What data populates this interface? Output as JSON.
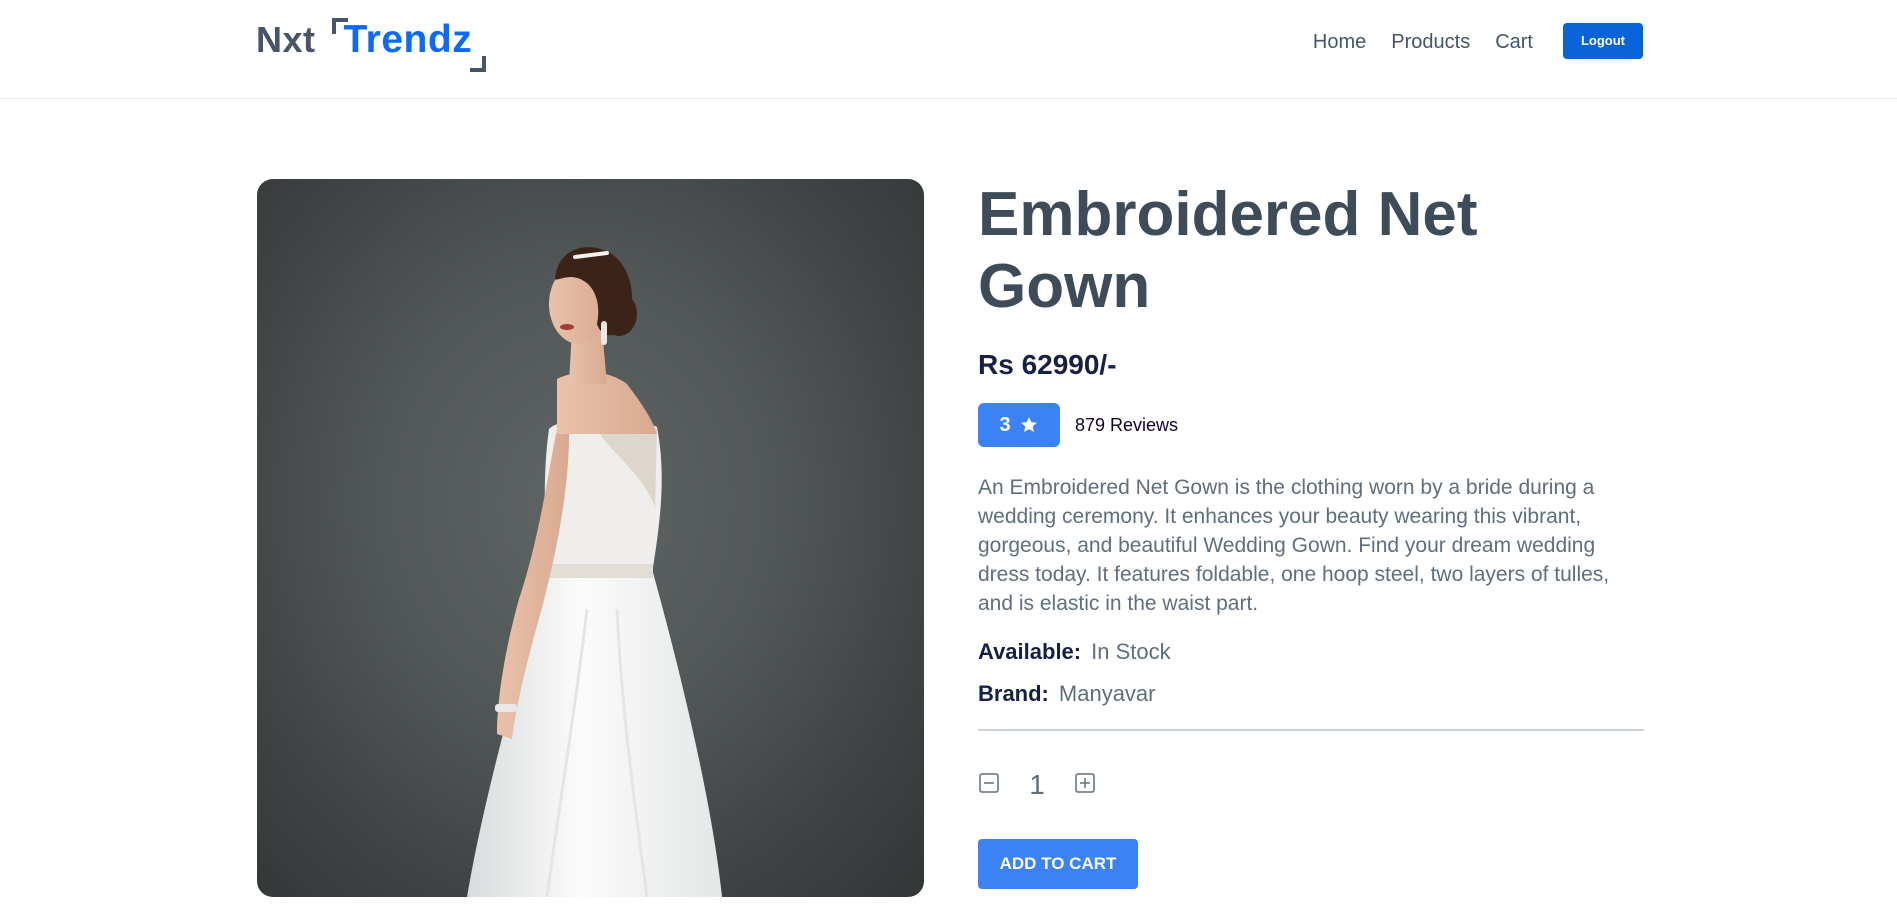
{
  "header": {
    "logo_part1": "Nxt",
    "logo_part2": "Trendz",
    "nav": [
      {
        "label": "Home"
      },
      {
        "label": "Products"
      },
      {
        "label": "Cart"
      }
    ],
    "logout_label": "Logout"
  },
  "product": {
    "image_alt": "bride in white embroidered net gown",
    "title": "Embroidered Net Gown",
    "price": "Rs 62990/-",
    "rating": "3",
    "rating_icon": "star-icon",
    "reviews": "879 Reviews",
    "description": "An Embroidered Net Gown is the clothing worn by a bride during a wedding ceremony. It enhances your beauty wearing this vibrant, gorgeous, and beautiful Wedding Gown. Find your dream wedding dress today. It features foldable, one hoop steel, two layers of tulles, and is elastic in the waist part.",
    "available_label": "Available:",
    "available_value": "In Stock",
    "brand_label": "Brand:",
    "brand_value": "Manyavar",
    "quantity": "1",
    "decrement_icon": "minus-square-icon",
    "increment_icon": "plus-square-icon",
    "add_to_cart_label": "ADD TO CART"
  },
  "colors": {
    "brand_blue": "#0b69ff",
    "button_blue": "#3b82f6",
    "logout_blue": "#0b63d9",
    "heading": "#3e4c59",
    "text_muted": "#616e7c",
    "dark_text": "#171f46"
  }
}
